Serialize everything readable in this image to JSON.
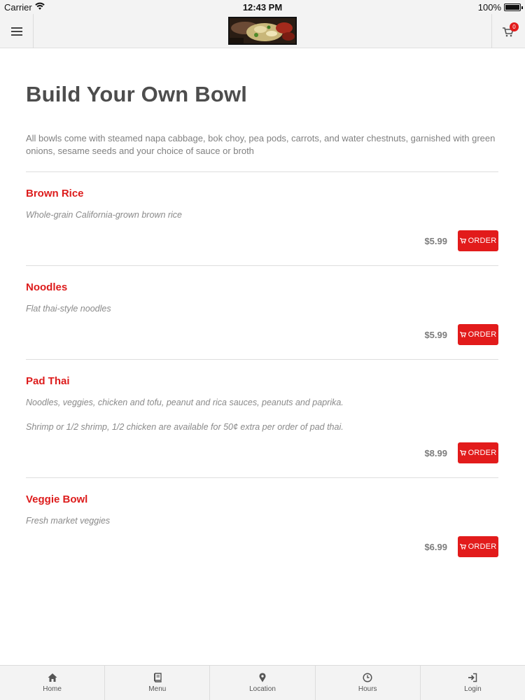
{
  "status_bar": {
    "carrier": "Carrier",
    "time": "12:43 PM",
    "battery": "100%"
  },
  "header": {
    "cart_count": "0"
  },
  "page": {
    "title": "Build Your Own Bowl",
    "intro": "All bowls come with steamed napa cabbage, bok choy, pea pods, carrots, and water chestnuts, garnished with green onions, sesame seeds and your choice of sauce or broth"
  },
  "items": [
    {
      "name": "Brown Rice",
      "description": "Whole-grain California-grown brown rice",
      "price": "$5.99",
      "order_label": "ORDER"
    },
    {
      "name": "Noodles",
      "description": "Flat thai-style noodles",
      "price": "$5.99",
      "order_label": "ORDER"
    },
    {
      "name": "Pad Thai",
      "description": "Noodles, veggies, chicken and tofu, peanut and rica sauces, peanuts and paprika.",
      "description2": "Shrimp or 1/2 shrimp, 1/2 chicken are available for 50¢ extra per order of pad thai.",
      "price": "$8.99",
      "order_label": "ORDER"
    },
    {
      "name": "Veggie Bowl",
      "description": "Fresh market veggies",
      "price": "$6.99",
      "order_label": "ORDER"
    }
  ],
  "tabbar": {
    "tabs": [
      {
        "label": "Home",
        "icon": "home-icon"
      },
      {
        "label": "Menu",
        "icon": "book-icon"
      },
      {
        "label": "Location",
        "icon": "map-pin-icon"
      },
      {
        "label": "Hours",
        "icon": "clock-icon"
      },
      {
        "label": "Login",
        "icon": "login-icon"
      }
    ]
  },
  "colors": {
    "accent": "#e21b1b",
    "item_name": "#dd1c1c",
    "bar_background": "#f3f3f3"
  }
}
